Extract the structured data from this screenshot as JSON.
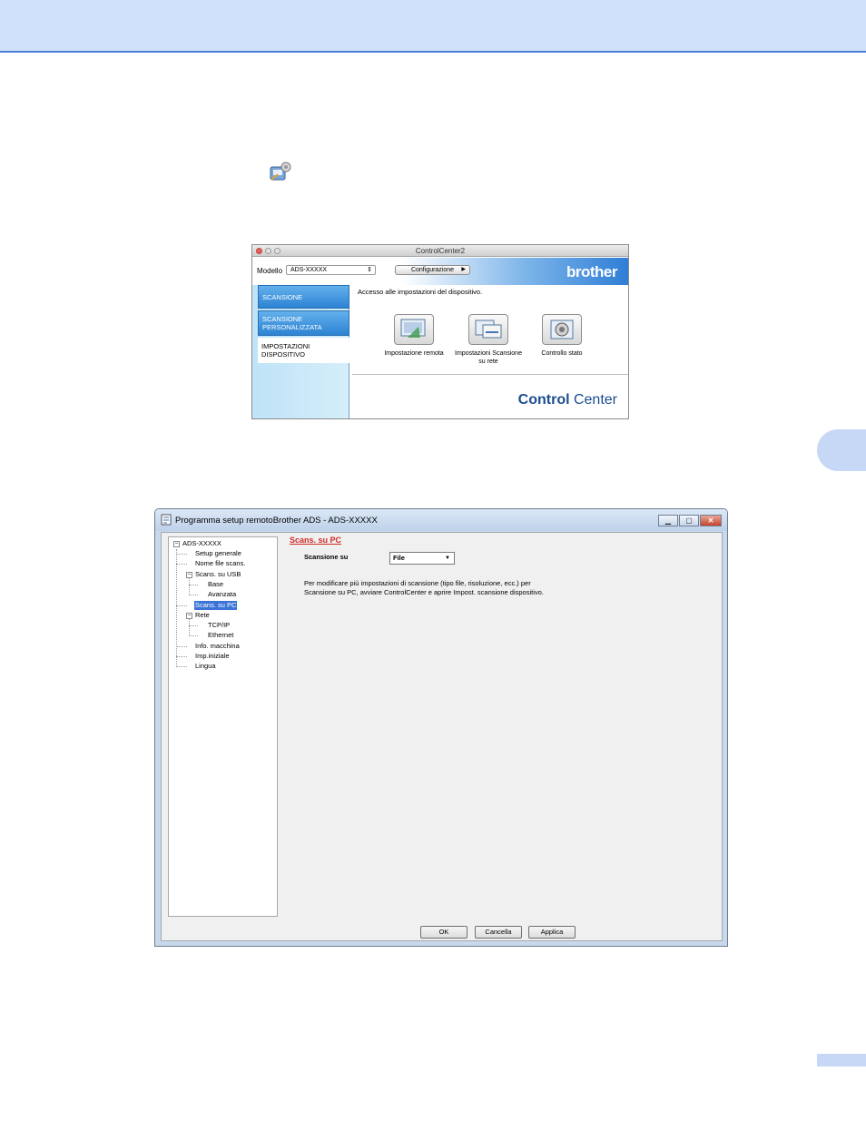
{
  "controlcenter": {
    "window_title": "ControlCenter2",
    "model_label": "Modello",
    "model_value": "ADS-XXXXX",
    "config_button": "Configurazione",
    "brand": "brother",
    "tabs": [
      {
        "label": "SCANSIONE"
      },
      {
        "label": "SCANSIONE PERSONALIZZATA"
      },
      {
        "label": "IMPOSTAZIONI DISPOSITIVO"
      }
    ],
    "description": "Accesso alle impostazioni del dispositivo.",
    "buttons": [
      {
        "label": "Impostazione remota",
        "icon": "remote-setup-icon"
      },
      {
        "label": "Impostazioni Scansione su rete",
        "icon": "network-scan-settings-icon"
      },
      {
        "label": "Controllo stato",
        "icon": "status-monitor-icon"
      }
    ],
    "logo_bold": "Control",
    "logo_regular": " Center"
  },
  "remote_setup": {
    "window_title": "Programma setup remotoBrother ADS - ADS-XXXXX",
    "tree": [
      {
        "label": "ADS-XXXXX"
      },
      {
        "label": "Setup generale"
      },
      {
        "label": "Nome file scans."
      },
      {
        "label": "Scans. su USB"
      },
      {
        "label": "Base"
      },
      {
        "label": "Avanzata"
      },
      {
        "label": "Scans. su PC"
      },
      {
        "label": "Rete"
      },
      {
        "label": "TCP/IP"
      },
      {
        "label": "Ethernet"
      },
      {
        "label": "Info. macchina"
      },
      {
        "label": "Imp.iniziale"
      },
      {
        "label": "Lingua"
      }
    ],
    "section_title": "Scans. su PC",
    "field_label": "Scansione su",
    "field_value": "File",
    "info_line1": "Per modificare più impostazioni di scansione (tipo file, risoluzione, ecc.) per",
    "info_line2": "Scansione su PC, avviare ControlCenter e aprire Impost. scansione dispositivo.",
    "ok": "OK",
    "cancel": "Cancella",
    "apply": "Applica"
  },
  "colors": {
    "header_band": "#cfe0fb",
    "brother_blue": "#2f7ed6",
    "section_title_red": "#d22b2b",
    "tree_selection": "#3a74d7"
  }
}
